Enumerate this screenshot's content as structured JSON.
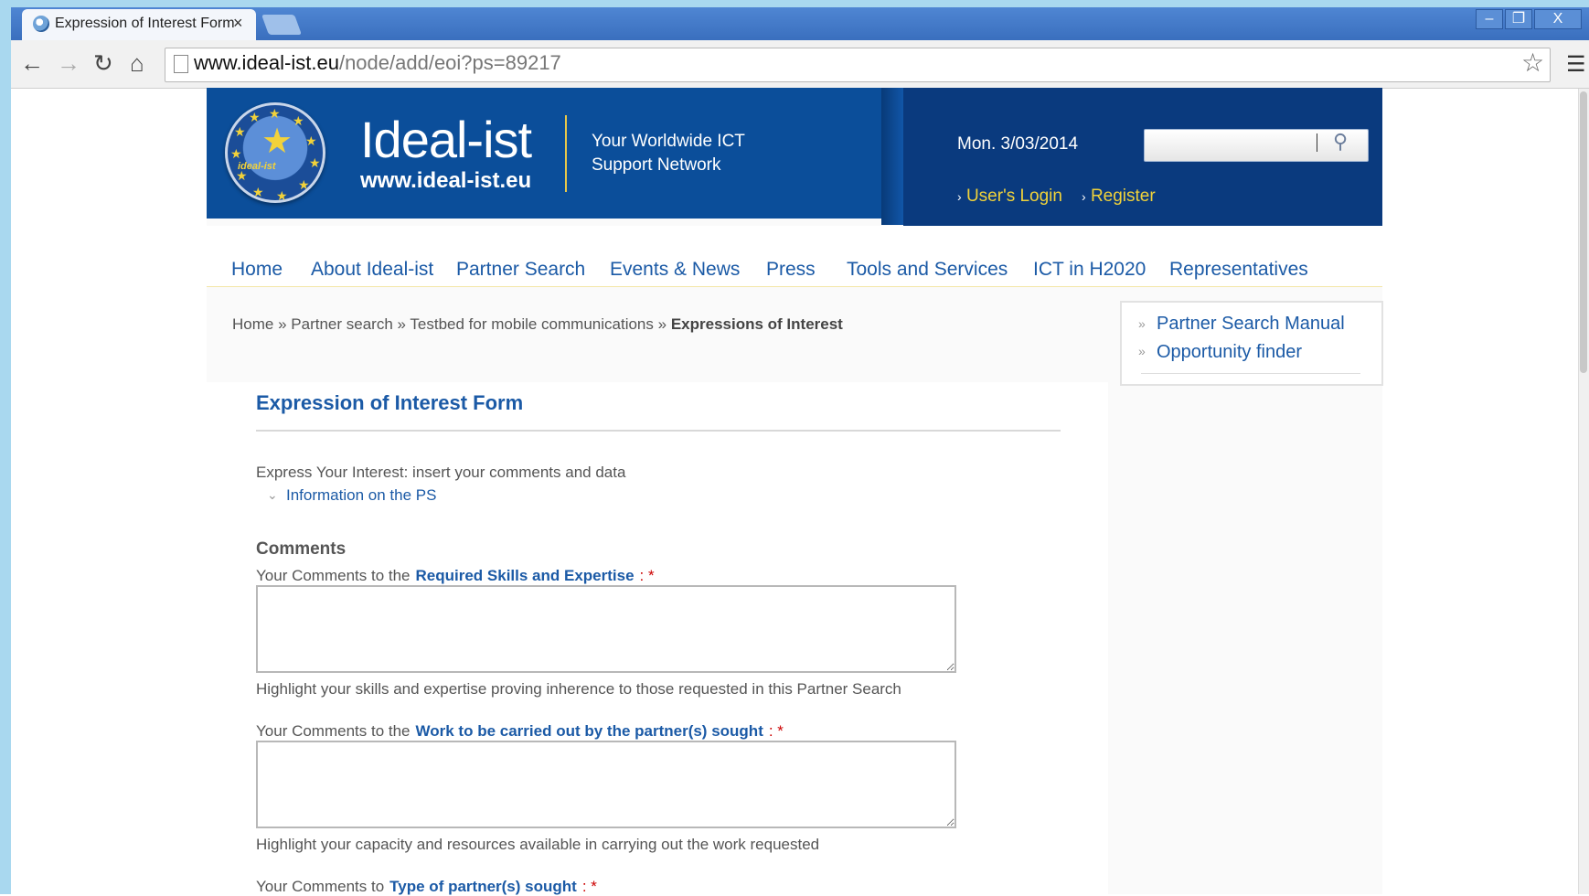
{
  "browser": {
    "tab_title": "Expression of Interest Form",
    "tab_close": "×",
    "url_host": "www.ideal-ist.eu",
    "url_path": "/node/add/eoi?ps=89217",
    "window_buttons": [
      "–",
      "❐",
      "X"
    ]
  },
  "header": {
    "brand_name": "Ideal-ist",
    "brand_url": "www.ideal-ist.eu",
    "logo_text": "ideal-ist",
    "tagline_line1": "Your Worldwide ICT",
    "tagline_line2": "Support Network",
    "date": "Mon. 3/03/2014",
    "search_placeholder": "",
    "login_label": "User's Login",
    "register_label": "Register"
  },
  "nav": {
    "items": [
      "Home",
      "About Ideal-ist",
      "Partner Search",
      "Events & News",
      "Press",
      "Tools and Services",
      "ICT in H2020",
      "Representatives"
    ]
  },
  "breadcrumb": {
    "items": [
      "Home",
      "Partner search",
      "Testbed for mobile communications"
    ],
    "current": "Expressions of Interest",
    "separator": "»"
  },
  "sidebar": {
    "links": [
      "Partner Search Manual",
      "Opportunity finder"
    ]
  },
  "form": {
    "title": "Expression of Interest Form",
    "intro": "Express Your Interest: insert your comments and data",
    "info_link": "Information on the PS",
    "comments_heading": "Comments",
    "fields": [
      {
        "prefix": "Your Comments to the",
        "highlight": "Required Skills and Expertise",
        "required_mark": ": *",
        "value": "",
        "hint": "Highlight your skills and expertise proving inherence to those requested in this Partner Search"
      },
      {
        "prefix": "Your Comments to the",
        "highlight": "Work to be carried out by the partner(s) sought",
        "required_mark": ": *",
        "value": "",
        "hint": "Highlight your capacity and resources available in carrying out the work requested"
      },
      {
        "prefix": "Your Comments to",
        "highlight": "Type of partner(s) sought",
        "required_mark": ": *"
      }
    ]
  },
  "colors": {
    "header_blue": "#0b4e9a",
    "header_dark": "#0a3a7e",
    "link_blue": "#1b5aa6",
    "accent_yellow": "#f0d23a",
    "required_red": "#cc0000"
  }
}
